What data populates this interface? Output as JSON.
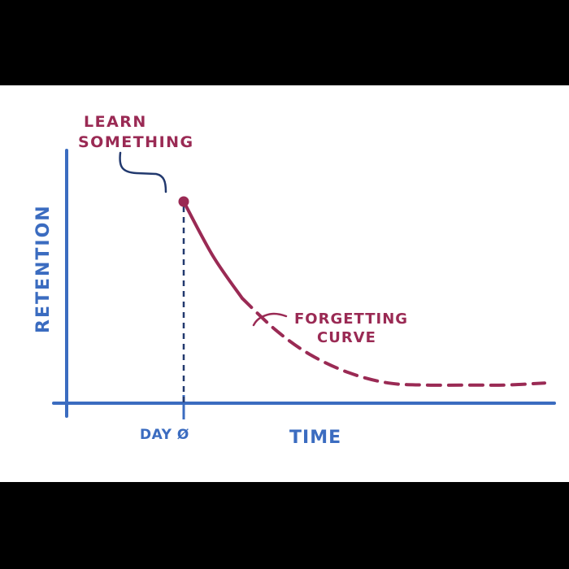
{
  "chart_data": {
    "type": "line",
    "title": "",
    "xlabel": "TIME",
    "ylabel": "RETENTION",
    "x_tick_label": "DAY Ø",
    "annotations": {
      "learn_line1": "LEARN",
      "learn_line2": "SOMETHING",
      "curve_line1": "FORGETTING",
      "curve_line2": "CURVE"
    },
    "xlim": [
      0,
      10
    ],
    "ylim": [
      0,
      100
    ],
    "day0_x": 2.4,
    "series": [
      {
        "name": "",
        "x": [
          2.4,
          3.0,
          3.6,
          4.3,
          5.0,
          5.8,
          6.6,
          7.4,
          8.3,
          9.0,
          9.8
        ],
        "y": [
          100,
          73,
          52,
          36,
          24,
          15,
          10,
          9,
          9,
          9,
          10
        ]
      }
    ],
    "colors": {
      "axis": "#3b6cc0",
      "curve": "#9a2a54"
    }
  }
}
